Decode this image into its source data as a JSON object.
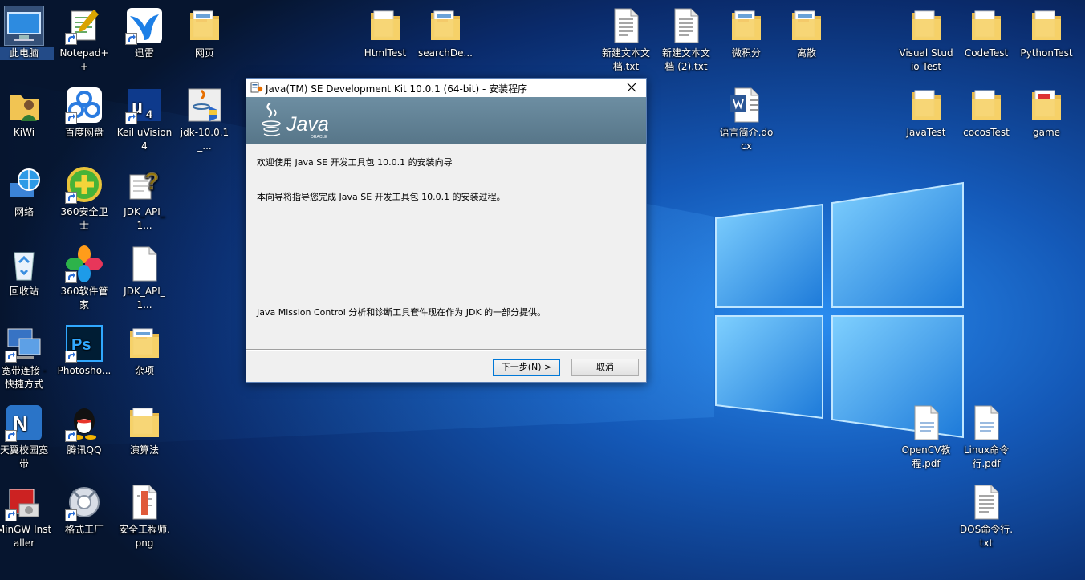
{
  "desktop": {
    "icons": [
      {
        "id": "this-pc",
        "label": "此电脑",
        "type": "pc",
        "shortcut": false,
        "selected": true
      },
      {
        "id": "notepad",
        "label": "Notepad++",
        "type": "notepad",
        "shortcut": true
      },
      {
        "id": "xunlei",
        "label": "迅雷",
        "type": "bird",
        "shortcut": true
      },
      {
        "id": "web",
        "label": "网页",
        "type": "folder-doc",
        "shortcut": false
      },
      {
        "id": "htmltest",
        "label": "HtmlTest",
        "type": "folder",
        "shortcut": false
      },
      {
        "id": "searchde",
        "label": "searchDe...",
        "type": "folder-doc",
        "shortcut": false
      },
      {
        "id": "newtxt1",
        "label": "新建文本文档.txt",
        "type": "txt",
        "shortcut": false
      },
      {
        "id": "newtxt2",
        "label": "新建文本文档 (2).txt",
        "type": "txt",
        "shortcut": false
      },
      {
        "id": "weijifen",
        "label": "微积分",
        "type": "folder-doc",
        "shortcut": false
      },
      {
        "id": "lisan",
        "label": "离散",
        "type": "folder-doc",
        "shortcut": false
      },
      {
        "id": "vstest",
        "label": "Visual Studio Test",
        "type": "folder",
        "shortcut": false
      },
      {
        "id": "codetest",
        "label": "CodeTest",
        "type": "folder",
        "shortcut": false
      },
      {
        "id": "pythontest",
        "label": "PythonTest",
        "type": "folder",
        "shortcut": false
      },
      {
        "id": "kiwi",
        "label": "KiWi",
        "type": "user",
        "shortcut": false
      },
      {
        "id": "baidu",
        "label": "百度网盘",
        "type": "cloud",
        "shortcut": true
      },
      {
        "id": "keil",
        "label": "Keil uVision4",
        "type": "keil",
        "shortcut": true
      },
      {
        "id": "jdk",
        "label": "jdk-10.0.1_...",
        "type": "java",
        "shortcut": false
      },
      {
        "id": "yuyan",
        "label": "语言简介.docx",
        "type": "word",
        "shortcut": false
      },
      {
        "id": "javatest",
        "label": "JavaTest",
        "type": "folder",
        "shortcut": false
      },
      {
        "id": "cocostest",
        "label": "cocosTest",
        "type": "folder",
        "shortcut": false
      },
      {
        "id": "game",
        "label": "game",
        "type": "folder-pdf",
        "shortcut": false
      },
      {
        "id": "network",
        "label": "网络",
        "type": "globe",
        "shortcut": false
      },
      {
        "id": "360safe",
        "label": "360安全卫士",
        "type": "plus360",
        "shortcut": true
      },
      {
        "id": "jdkapi1",
        "label": "JDK_API_1...",
        "type": "help",
        "shortcut": false
      },
      {
        "id": "recycle",
        "label": "回收站",
        "type": "recycle",
        "shortcut": false
      },
      {
        "id": "360mgr",
        "label": "360软件管家",
        "type": "petals",
        "shortcut": true
      },
      {
        "id": "jdkapi2",
        "label": "JDK_API_1...",
        "type": "blank",
        "shortcut": false
      },
      {
        "id": "broadband",
        "label": "宽带连接 - 快捷方式",
        "type": "broadband",
        "shortcut": true
      },
      {
        "id": "photoshop",
        "label": "Photosho...",
        "type": "ps",
        "shortcut": true
      },
      {
        "id": "zaxiang",
        "label": "杂项",
        "type": "folder-doc",
        "shortcut": false
      },
      {
        "id": "tianyi",
        "label": "天翼校园宽带",
        "type": "tianyi",
        "shortcut": true
      },
      {
        "id": "qq",
        "label": "腾讯QQ",
        "type": "qq",
        "shortcut": true
      },
      {
        "id": "suanfa",
        "label": "演算法",
        "type": "folder",
        "shortcut": false
      },
      {
        "id": "opencv",
        "label": "OpenCV教程.pdf",
        "type": "pdf",
        "shortcut": false
      },
      {
        "id": "linuxcmd",
        "label": "Linux命令行.pdf",
        "type": "pdf",
        "shortcut": false
      },
      {
        "id": "mingw",
        "label": "MinGW Installer",
        "type": "mingw",
        "shortcut": true
      },
      {
        "id": "geshi",
        "label": "格式工厂",
        "type": "geshi",
        "shortcut": true
      },
      {
        "id": "anquan",
        "label": "安全工程师.png",
        "type": "png",
        "shortcut": false
      },
      {
        "id": "doscmd",
        "label": "DOS命令行.txt",
        "type": "txt",
        "shortcut": false
      }
    ]
  },
  "dialog": {
    "title": "Java(TM) SE Development Kit 10.0.1 (64-bit) - 安装程序",
    "logo_text": "Java",
    "logo_subtext": "ORACLE",
    "welcome": "欢迎使用 Java SE 开发工具包 10.0.1 的安装向导",
    "guide": "本向导将指导您完成 Java SE 开发工具包 10.0.1 的安装过程。",
    "jmc_note": "Java Mission Control 分析和诊断工具套件现在作为 JDK 的一部分提供。",
    "next_label": "下一步(N) >",
    "cancel_label": "取消"
  },
  "colors": {
    "wallpaper_dark": "#06152f",
    "wallpaper_blue": "#1e78d6",
    "banner": "#5f7f94",
    "annotation_red": "#e8102a",
    "focus_blue": "#0078d7"
  }
}
